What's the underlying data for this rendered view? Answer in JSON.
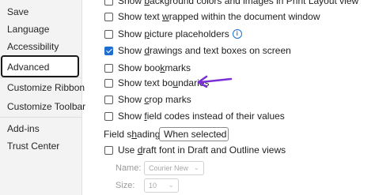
{
  "sidebar": {
    "items": [
      {
        "label": "Save"
      },
      {
        "label": "Language"
      },
      {
        "label": "Accessibility"
      },
      {
        "label": "Advanced"
      },
      {
        "label": "Customize Ribbon"
      },
      {
        "label": "Customize Toolbar"
      },
      {
        "label": "Add-ins"
      },
      {
        "label": "Trust Center"
      }
    ],
    "selected": "Advanced"
  },
  "options": [
    {
      "label_pre": "Show ",
      "label_u": "b",
      "label_post": "ackground colors and images in Print Layout view",
      "checked": false
    },
    {
      "label_pre": "Show text ",
      "label_u": "w",
      "label_post": "rapped within the document window",
      "checked": false
    },
    {
      "label_pre": "Show ",
      "label_u": "p",
      "label_post": "icture placeholders",
      "checked": false
    },
    {
      "label_pre": "Show ",
      "label_u": "d",
      "label_post": "rawings and text boxes on screen",
      "checked": true
    },
    {
      "label_pre": "Show boo",
      "label_u": "k",
      "label_post": "marks",
      "checked": false
    },
    {
      "label_pre": "Show text bo",
      "label_u": "u",
      "label_post": "ndaries",
      "checked": false
    },
    {
      "label_pre": "Show ",
      "label_u": "c",
      "label_post": "rop marks",
      "checked": false
    },
    {
      "label_pre": "Show ",
      "label_u": "f",
      "label_post": "ield codes instead of their values",
      "checked": false
    }
  ],
  "field_shading": {
    "label_pre": "Field s",
    "label_u": "h",
    "label_post": "ading:",
    "value": "When selected"
  },
  "draft_font": {
    "label_pre": "Use ",
    "label_u": "d",
    "label_post": "raft font in Draft and Outline views",
    "checked": false
  },
  "font_name": {
    "label": "Name:",
    "value": "Courier New"
  },
  "font_size": {
    "label": "Size:",
    "value": "10"
  },
  "colors": {
    "accent": "#1c6fd1",
    "arrow": "#7b2fd6"
  }
}
